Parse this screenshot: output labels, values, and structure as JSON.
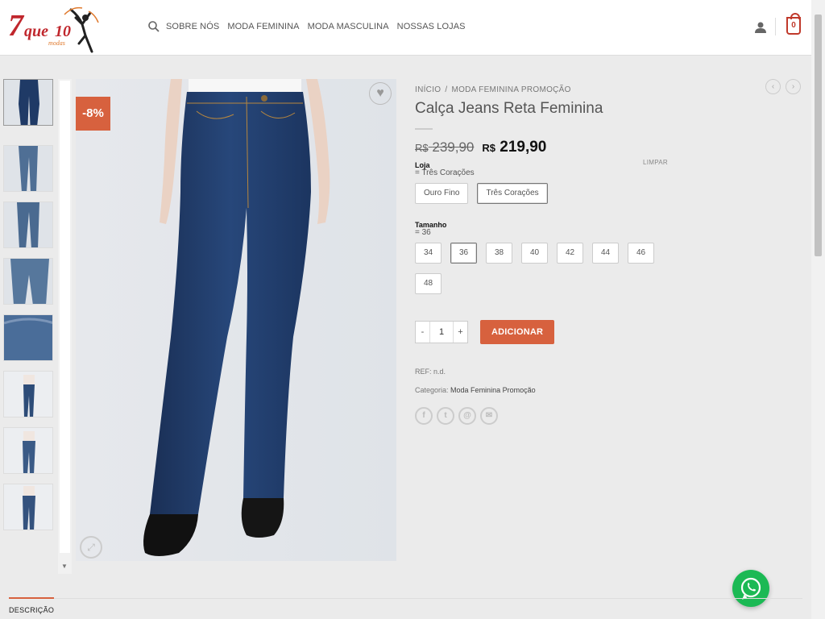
{
  "header": {
    "logo_text": "7que10",
    "logo_sub": "modas",
    "nav": [
      "SOBRE NÓS",
      "MODA FEMININA",
      "MODA MASCULINA",
      "NOSSAS LOJAS"
    ],
    "cart_count": "0"
  },
  "gallery": {
    "badge": "-8%",
    "thumbnail_count": 8
  },
  "product": {
    "breadcrumb": [
      "INÍCIO",
      "MODA FEMININA PROMOÇÃO"
    ],
    "breadcrumb_sep": "/",
    "title": "Calça Jeans Reta Feminina",
    "price_currency": "R$",
    "old_price": "239,90",
    "new_price": "219,90",
    "clear_label": "LIMPAR",
    "loja_label": "Loja",
    "loja_value": "= Três Corações",
    "loja_options": [
      "Ouro Fino",
      "Três Corações"
    ],
    "tamanho_label": "Tamanho",
    "tamanho_value": "= 36",
    "size_options": [
      "34",
      "36",
      "38",
      "40",
      "42",
      "44",
      "46",
      "48"
    ],
    "qty_minus": "-",
    "qty_value": "1",
    "qty_plus": "+",
    "add_label": "ADICIONAR",
    "ref": "REF: n.d.",
    "category_label": "Categoria:",
    "category_value": "Moda Feminina Promoção"
  },
  "tabs": {
    "description": "DESCRIÇÃO"
  },
  "colors": {
    "accent": "#d7613e",
    "whatsapp": "#1bb954"
  }
}
